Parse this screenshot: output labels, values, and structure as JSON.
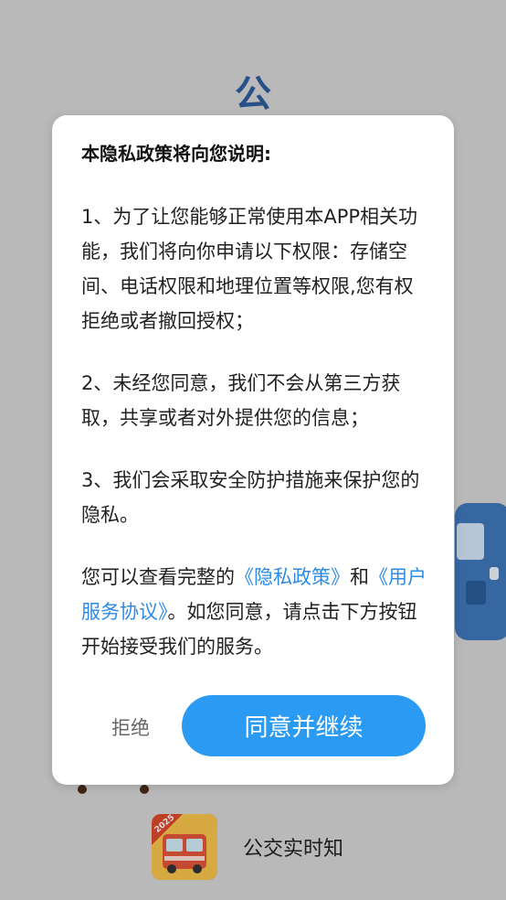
{
  "background": {
    "title": "公",
    "app_name": "公交实时知",
    "app_icon_badge": "2025",
    "accent_color": "#2c5c9a"
  },
  "dialog": {
    "title": "本隐私政策将向您说明:",
    "para1": "1、为了让您能够正常使用本APP相关功能，我们将向你申请以下权限：存储空间、电话权限和地理位置等权限,您有权拒绝或者撤回授权；",
    "para2": "2、未经您同意，我们不会从第三方获取，共享或者对外提供您的信息；",
    "para3": "3、我们会采取安全防护措施来保护您的隐私。",
    "para4_prefix": "您可以查看完整的",
    "privacy_link": "《隐私政策》",
    "para4_and": "和",
    "agreement_link": "《用户服务协议》",
    "para4_suffix": "。如您同意，请点击下方按钮开始接受我们的服务。",
    "reject_label": "拒绝",
    "agree_label": "同意并继续",
    "link_color": "#2f8be6",
    "button_color": "#2b9af3"
  }
}
